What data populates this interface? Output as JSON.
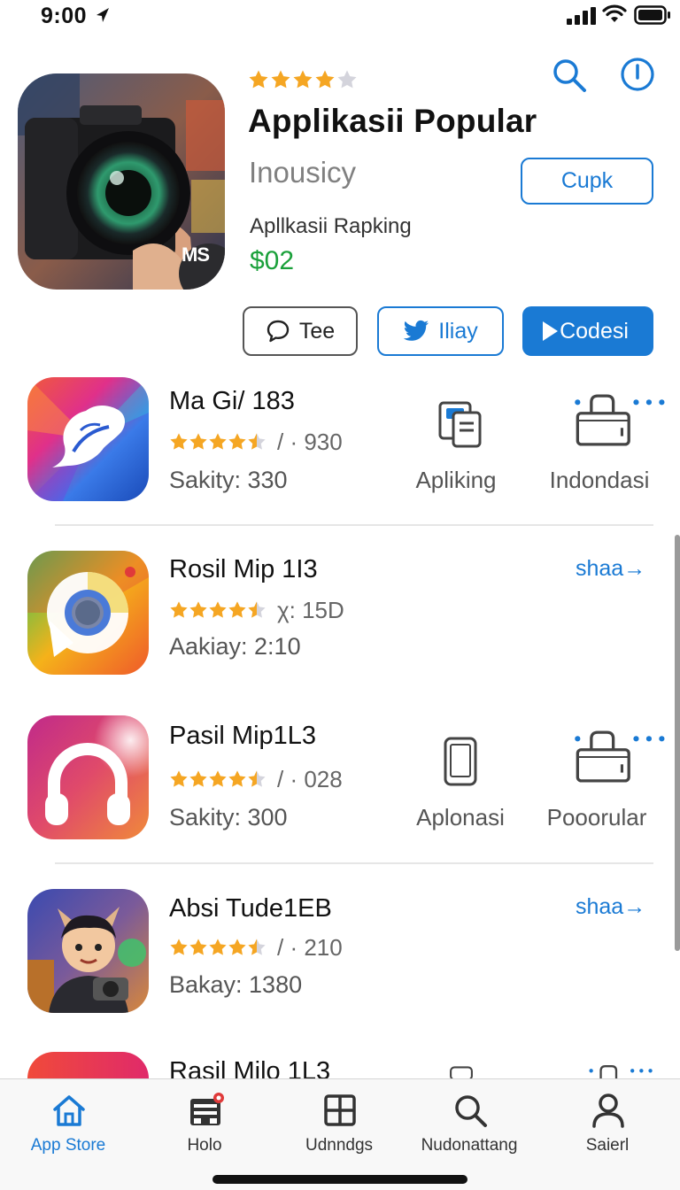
{
  "status_bar": {
    "time": "9:00"
  },
  "hero": {
    "title": "Applikasii Popular",
    "subtitle": "Inousicy",
    "caption": "Apllkasii Rapking",
    "price": "$02",
    "rating": 4,
    "badge_text": "MS",
    "button_label": "Cupk",
    "actions": {
      "tee": "Tee",
      "iliay": "Iliay",
      "codesi": "Codesi"
    }
  },
  "apps": [
    {
      "name": "Ma Gi/ 183",
      "rating": 4.5,
      "rating_count": "/ · 930",
      "meta": "Sakity: 330",
      "side_left": "Apliking",
      "side_right": "Indondasi"
    },
    {
      "name": "Rosil  Mip 1I3",
      "rating": 4.5,
      "rating_count": "χ: 15D",
      "meta": "Aakiay: 2:10",
      "link": "shaa→"
    },
    {
      "name": "Pasil  Mip1L3",
      "rating": 4.5,
      "rating_count": "/ · 028",
      "meta": "Sakity: 300",
      "side_left": "Aplonasi",
      "side_right": "Pooorular"
    },
    {
      "name": "Absi  Tude1EB",
      "rating": 4.5,
      "rating_count": "/ · 210",
      "meta": "Bakay: 1380",
      "link": "shaa→"
    },
    {
      "name": "Rasil  Milo 1L3"
    }
  ],
  "tabs": [
    {
      "label": "App Store",
      "icon": "house-icon"
    },
    {
      "label": "Holo",
      "icon": "inbox-icon"
    },
    {
      "label": "Udnndgs",
      "icon": "grid-icon"
    },
    {
      "label": "Nudonattang",
      "icon": "search-icon"
    },
    {
      "label": "Saierl",
      "icon": "person-icon"
    }
  ],
  "colors": {
    "accent": "#1a7ad4",
    "price": "#1aa03a",
    "star": "#f5a623"
  }
}
